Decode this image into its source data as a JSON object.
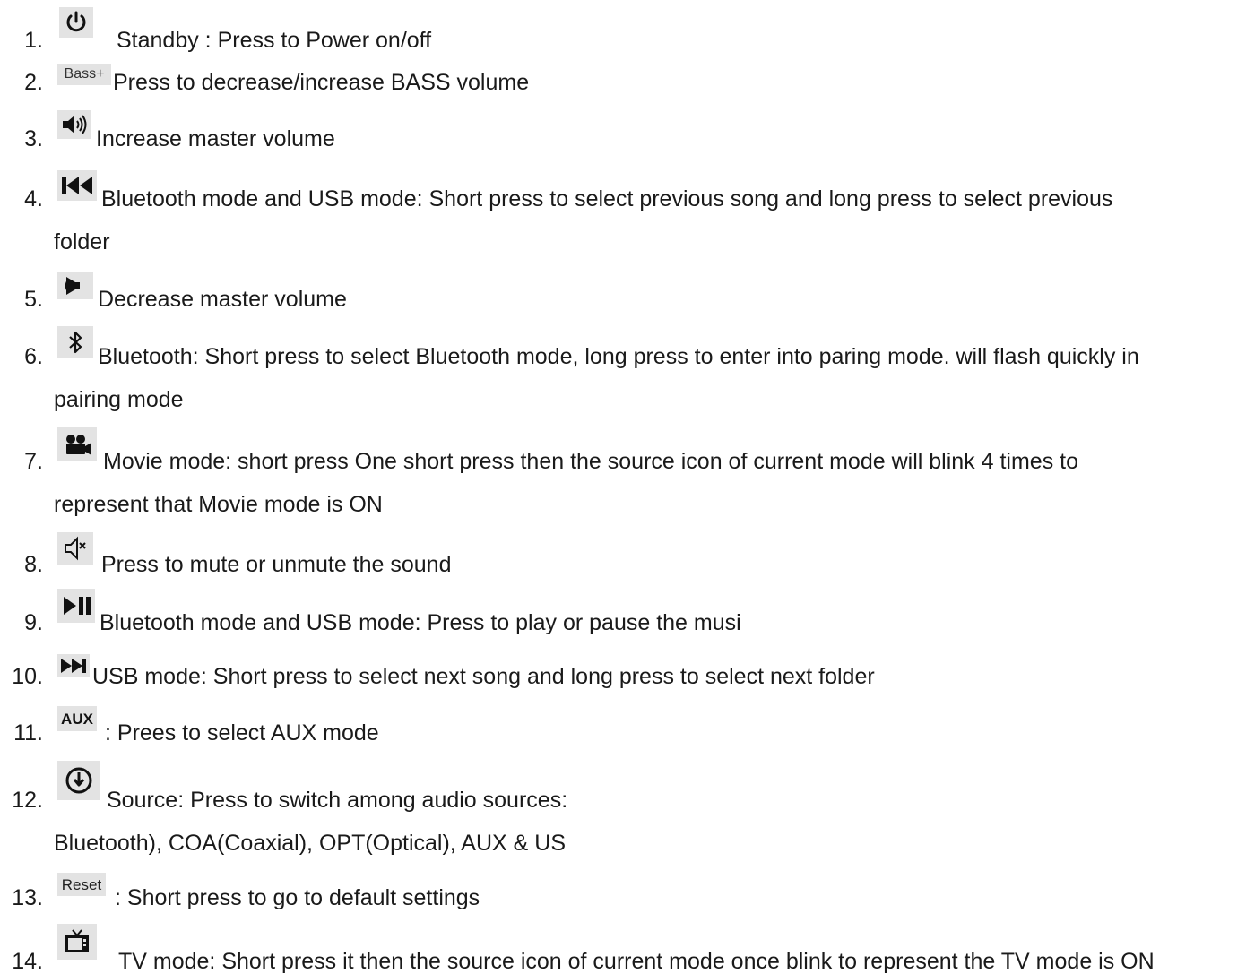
{
  "items": [
    {
      "num": "1.",
      "icon": "power-icon",
      "text": "Standby : Press to Power on/off"
    },
    {
      "num": "2.",
      "icon": "bass-plus-icon",
      "icon_label": "Bass+",
      "text": "Press to decrease/increase BASS volume"
    },
    {
      "num": "3.",
      "icon": "volume-up-icon",
      "text": "Increase master volume"
    },
    {
      "num": "4.",
      "icon": "previous-track-icon",
      "text": "Bluetooth mode and USB mode: Short press to select previous song and long press to select previous",
      "text2": "folder"
    },
    {
      "num": "5.",
      "icon": "volume-down-icon",
      "text": "Decrease master volume"
    },
    {
      "num": "6.",
      "icon": "bluetooth-icon",
      "text": "Bluetooth: Short press to select Bluetooth mode, long press to enter into paring mode. will flash quickly in",
      "text2": "pairing mode"
    },
    {
      "num": "7.",
      "icon": "movie-camera-icon",
      "text": "Movie mode: short press One short press then the source icon of current mode will blink 4 times to",
      "text2": "represent that Movie mode is ON"
    },
    {
      "num": "8.",
      "icon": "mute-icon",
      "text": "Press to mute or unmute the sound"
    },
    {
      "num": "9.",
      "icon": "play-pause-icon",
      "text": "Bluetooth mode and USB mode: Press to play or pause the musi"
    },
    {
      "num": "10.",
      "icon": "next-track-icon",
      "text": "USB mode: Short press to select next song and long press to select next folder"
    },
    {
      "num": "11.",
      "icon": "aux-icon",
      "icon_label": "AUX",
      "text": ": Prees to select AUX mode"
    },
    {
      "num": "12.",
      "icon": "source-icon",
      "text": "Source: Press to switch among audio sources:",
      "text2": "Bluetooth), COA(Coaxial), OPT(Optical), AUX & US"
    },
    {
      "num": "13.",
      "icon": "reset-icon",
      "icon_label": "Reset",
      "text": ": Short press to go to default settings"
    },
    {
      "num": "14.",
      "icon": "tv-icon",
      "text": "TV mode: Short press it then the source icon of current mode once blink to represent the TV mode is ON"
    }
  ]
}
